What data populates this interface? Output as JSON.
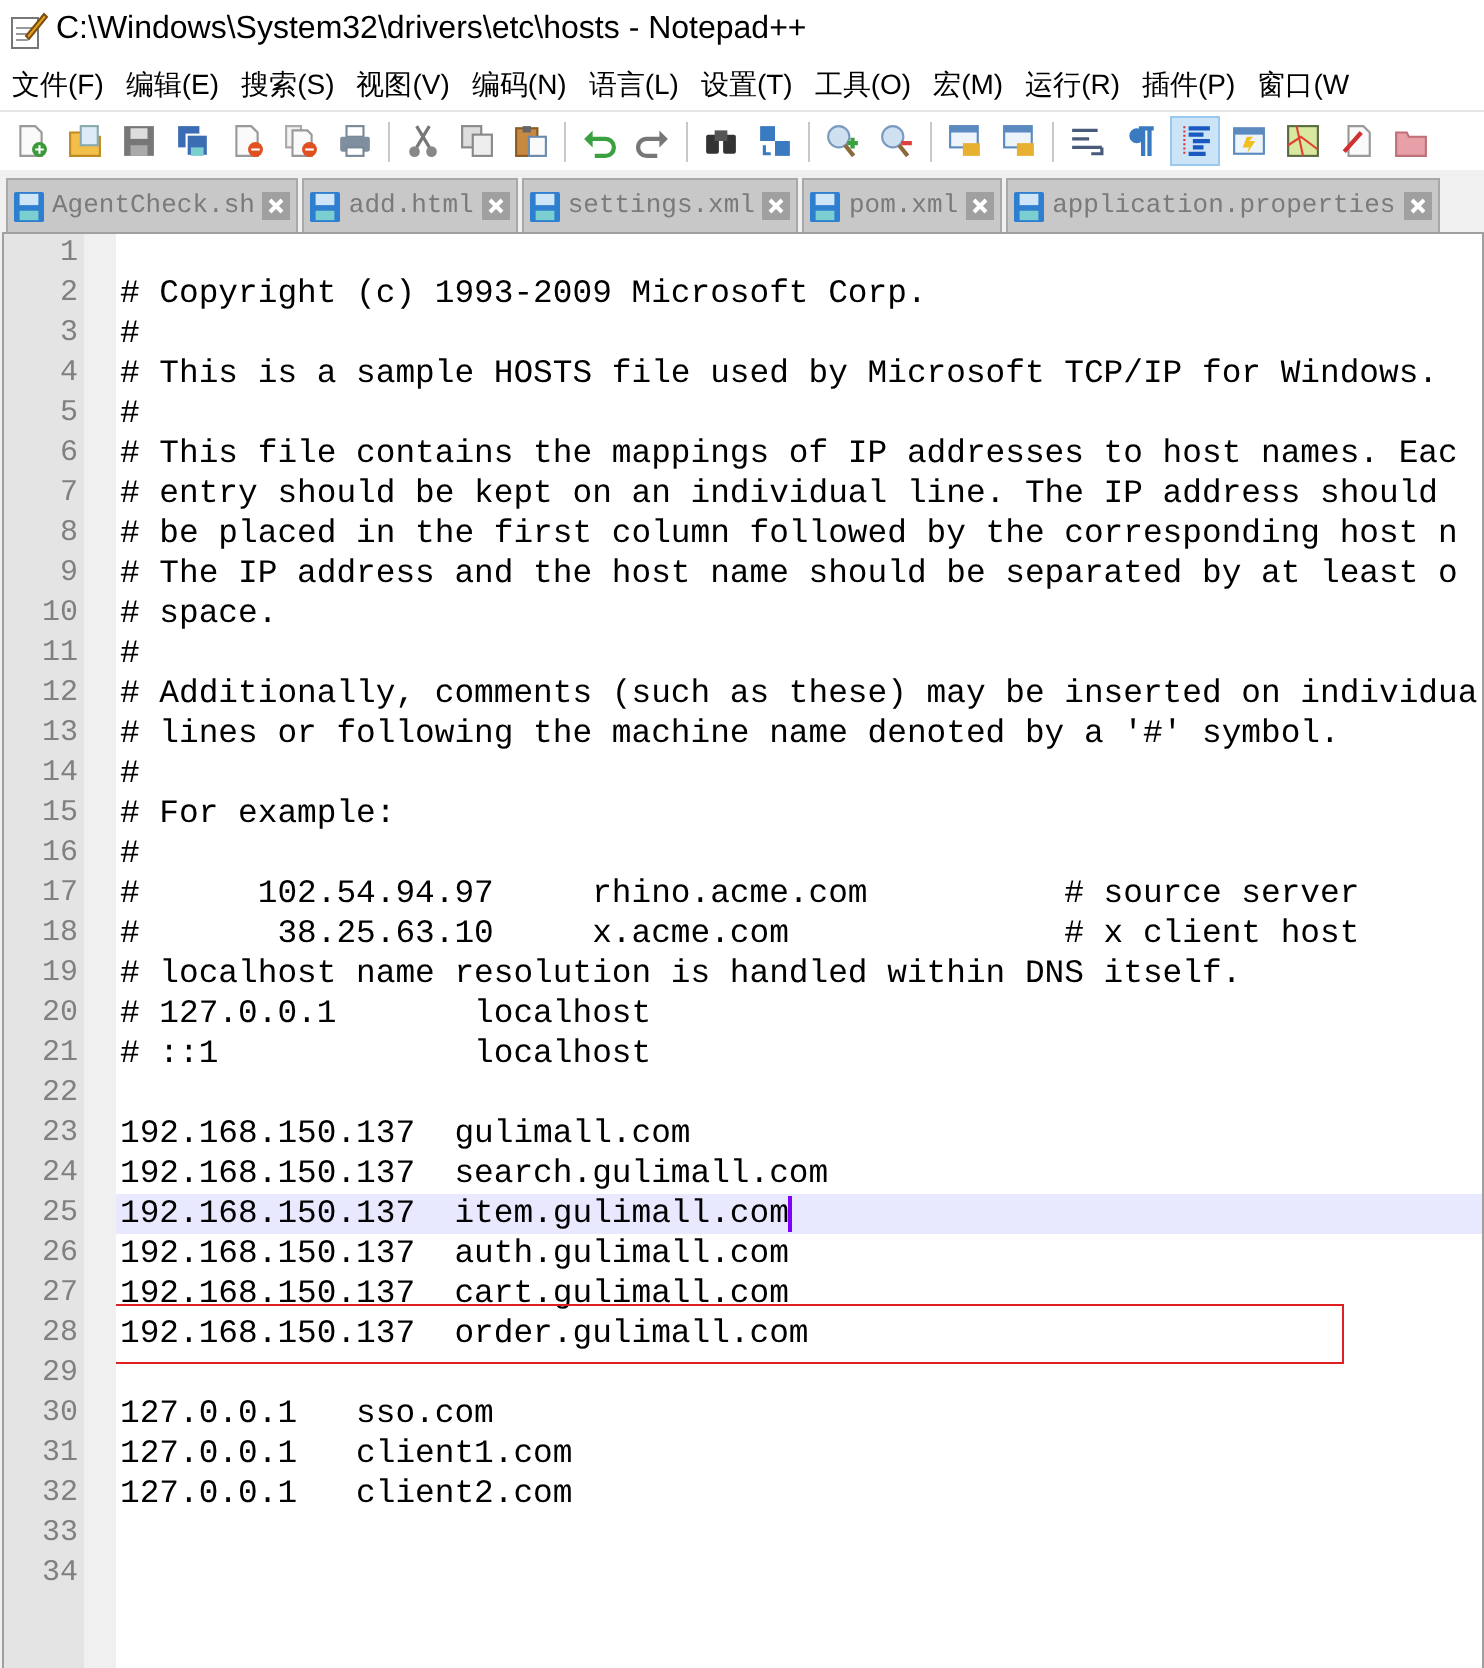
{
  "window": {
    "title": "C:\\Windows\\System32\\drivers\\etc\\hosts - Notepad++"
  },
  "menu": [
    "文件(F)",
    "编辑(E)",
    "搜索(S)",
    "视图(V)",
    "编码(N)",
    "语言(L)",
    "设置(T)",
    "工具(O)",
    "宏(M)",
    "运行(R)",
    "插件(P)",
    "窗口(W"
  ],
  "toolbar": [
    {
      "kind": "new",
      "pressed": false
    },
    {
      "kind": "open",
      "pressed": false
    },
    {
      "kind": "save",
      "pressed": false
    },
    {
      "kind": "save-all",
      "pressed": false
    },
    {
      "kind": "close",
      "pressed": false
    },
    {
      "kind": "close-all",
      "pressed": false
    },
    {
      "kind": "print",
      "pressed": false
    },
    {
      "kind": "sep"
    },
    {
      "kind": "cut",
      "pressed": false
    },
    {
      "kind": "copy",
      "pressed": false
    },
    {
      "kind": "paste",
      "pressed": false
    },
    {
      "kind": "sep"
    },
    {
      "kind": "undo",
      "pressed": false
    },
    {
      "kind": "redo",
      "pressed": false
    },
    {
      "kind": "sep"
    },
    {
      "kind": "find",
      "pressed": false
    },
    {
      "kind": "replace",
      "pressed": false
    },
    {
      "kind": "sep"
    },
    {
      "kind": "zoom-in",
      "pressed": false
    },
    {
      "kind": "zoom-out",
      "pressed": false
    },
    {
      "kind": "sep"
    },
    {
      "kind": "sync-v",
      "pressed": false
    },
    {
      "kind": "sync-h",
      "pressed": false
    },
    {
      "kind": "sep"
    },
    {
      "kind": "wrap",
      "pressed": false
    },
    {
      "kind": "pilcrow",
      "pressed": false
    },
    {
      "kind": "indent-guide",
      "pressed": true
    },
    {
      "kind": "doc-map",
      "pressed": false
    },
    {
      "kind": "function-list",
      "pressed": false
    },
    {
      "kind": "clipboard",
      "pressed": false
    },
    {
      "kind": "folder",
      "pressed": false
    }
  ],
  "tabs": [
    {
      "label": "AgentCheck.sh",
      "selected": false
    },
    {
      "label": "add.html",
      "selected": false
    },
    {
      "label": "settings.xml",
      "selected": false
    },
    {
      "label": "pom.xml",
      "selected": false
    },
    {
      "label": "application.properties",
      "selected": false
    }
  ],
  "editor": {
    "lines": [
      {
        "number": "1"
      },
      {
        "number": "2",
        "text": "# Copyright (c) 1993-2009 Microsoft Corp."
      },
      {
        "number": "3",
        "text": "#"
      },
      {
        "number": "4",
        "text": "# This is a sample HOSTS file used by Microsoft TCP/IP for Windows."
      },
      {
        "number": "5",
        "text": "#"
      },
      {
        "number": "6",
        "text": "# This file contains the mappings of IP addresses to host names. Eac"
      },
      {
        "number": "7",
        "text": "# entry should be kept on an individual line. The IP address should"
      },
      {
        "number": "8",
        "text": "# be placed in the first column followed by the corresponding host n"
      },
      {
        "number": "9",
        "text": "# The IP address and the host name should be separated by at least o"
      },
      {
        "number": "10",
        "text": "# space."
      },
      {
        "number": "11",
        "text": "#"
      },
      {
        "number": "12",
        "text": "# Additionally, comments (such as these) may be inserted on individua"
      },
      {
        "number": "13",
        "text": "# lines or following the machine name denoted by a '#' symbol."
      },
      {
        "number": "14",
        "text": "#"
      },
      {
        "number": "15",
        "text": "# For example:"
      },
      {
        "number": "16",
        "text": "#"
      },
      {
        "number": "17",
        "text": "#      102.54.94.97     rhino.acme.com          # source server"
      },
      {
        "number": "18",
        "text": "#       38.25.63.10     x.acme.com              # x client host"
      },
      {
        "number": "19",
        "text": "# localhost name resolution is handled within DNS itself."
      },
      {
        "number": "20",
        "text": "# 127.0.0.1       localhost"
      },
      {
        "number": "21",
        "text": "# ::1             localhost"
      },
      {
        "number": "22"
      },
      {
        "number": "23",
        "text": "192.168.150.137  gulimall.com"
      },
      {
        "number": "24",
        "text": "192.168.150.137  search.gulimall.com"
      },
      {
        "number": "25",
        "text": "192.168.150.137  item.gulimall.com",
        "current": true
      },
      {
        "number": "26",
        "text": "192.168.150.137  auth.gulimall.com"
      },
      {
        "number": "27",
        "text": "192.168.150.137  cart.gulimall.com"
      },
      {
        "number": "28",
        "text": "192.168.150.137  order.gulimall.com",
        "boxed": true
      },
      {
        "number": "29"
      },
      {
        "number": "30",
        "text": "127.0.0.1   sso.com"
      },
      {
        "number": "31",
        "text": "127.0.0.1   client1.com"
      },
      {
        "number": "32",
        "text": "127.0.0.1   client2.com"
      },
      {
        "number": "33"
      },
      {
        "number": "34"
      }
    ]
  }
}
